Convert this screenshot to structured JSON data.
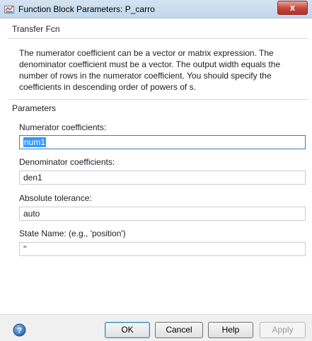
{
  "window": {
    "title": "Function Block Parameters: P_carro",
    "close_label": "x"
  },
  "block": {
    "type": "Transfer Fcn",
    "description": "The numerator coefficient can be a vector or matrix expression. The denominator coefficient must be a vector. The output width equals the number of rows in the numerator coefficient. You should specify the coefficients in descending order of powers of s."
  },
  "parameters": {
    "title": "Parameters",
    "numerator": {
      "label": "Numerator coefficients:",
      "value": "num1"
    },
    "denominator": {
      "label": "Denominator coefficients:",
      "value": "den1"
    },
    "tolerance": {
      "label": "Absolute tolerance:",
      "value": "auto"
    },
    "state_name": {
      "label": "State Name: (e.g., 'position')",
      "value": "''"
    }
  },
  "buttons": {
    "ok": "OK",
    "cancel": "Cancel",
    "help": "Help",
    "apply": "Apply"
  },
  "icons": {
    "window_icon": "simulink-block-icon",
    "help_icon": "help-question-icon",
    "close_icon": "close-icon"
  },
  "colors": {
    "titlebar": "#c9dbef",
    "close_button": "#c7443a",
    "selection": "#3399ff",
    "focus_border": "#3c7fb1",
    "footer": "#f0f0f0"
  }
}
